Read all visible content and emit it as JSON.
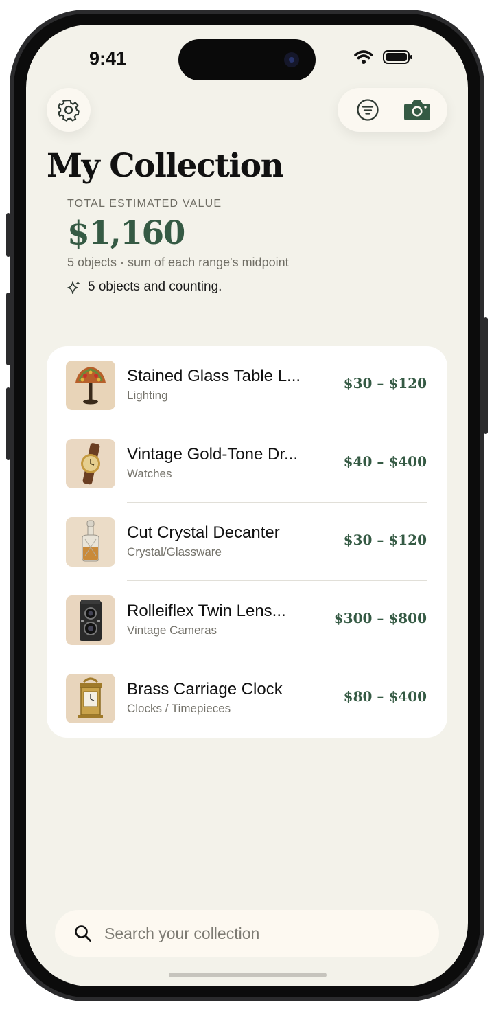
{
  "status_bar": {
    "time": "9:41"
  },
  "toolbar": {
    "settings_icon": "gear-icon",
    "filter_icon": "filter-icon",
    "camera_icon": "camera-icon"
  },
  "header": {
    "title": "My Collection"
  },
  "summary": {
    "label": "TOTAL ESTIMATED VALUE",
    "value": "$1,160",
    "subtitle": "5 objects · sum of each range's midpoint",
    "note": "5 objects and counting."
  },
  "items": [
    {
      "title": "Stained Glass Table L...",
      "category": "Lighting",
      "price": "$30 – $120",
      "icon": "table-lamp"
    },
    {
      "title": "Vintage Gold-Tone Dr...",
      "category": "Watches",
      "price": "$40 – $400",
      "icon": "wristwatch"
    },
    {
      "title": "Cut Crystal Decanter",
      "category": "Crystal/Glassware",
      "price": "$30 – $120",
      "icon": "decanter"
    },
    {
      "title": "Rolleiflex Twin Lens...",
      "category": "Vintage Cameras",
      "price": "$300 – $800",
      "icon": "twin-lens-camera"
    },
    {
      "title": "Brass Carriage Clock",
      "category": "Clocks / Timepieces",
      "price": "$80 – $400",
      "icon": "carriage-clock"
    }
  ],
  "search": {
    "placeholder": "Search your collection",
    "value": ""
  },
  "colors": {
    "background": "#f3f2ea",
    "accent": "#355a44",
    "card": "#ffffff",
    "text_secondary": "#6f6d64"
  }
}
